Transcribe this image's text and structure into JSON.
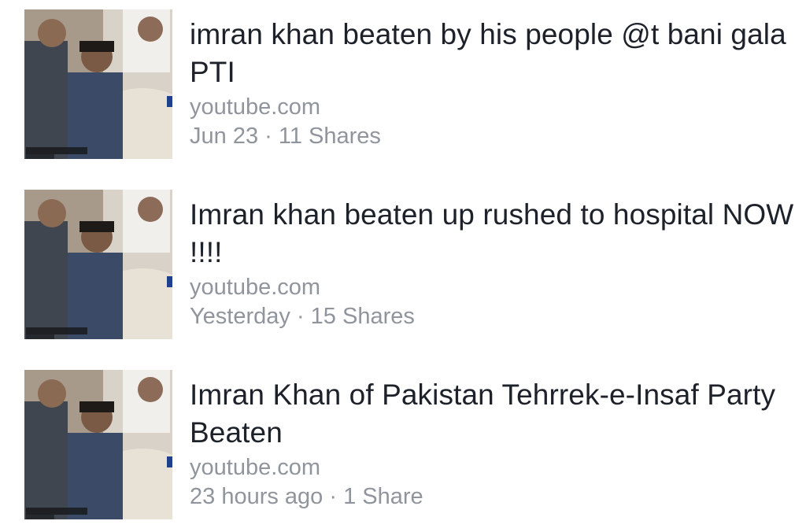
{
  "results": [
    {
      "title": "imran khan beaten by his people @t bani gala PTI",
      "domain": "youtube.com",
      "meta": "Jun 23 · 11 Shares"
    },
    {
      "title": "Imran khan beaten up rushed to hospital NOW !!!!",
      "domain": "youtube.com",
      "meta": "Yesterday · 15 Shares"
    },
    {
      "title": "Imran Khan of Pakistan Tehrrek-e-Insaf Party Beaten",
      "domain": "youtube.com",
      "meta": "23 hours ago · 1 Share"
    }
  ],
  "colors": {
    "title": "#1d2129",
    "secondary": "#90949c",
    "background": "#ffffff"
  },
  "icons": {
    "thumbnail": "video-thumbnail"
  }
}
